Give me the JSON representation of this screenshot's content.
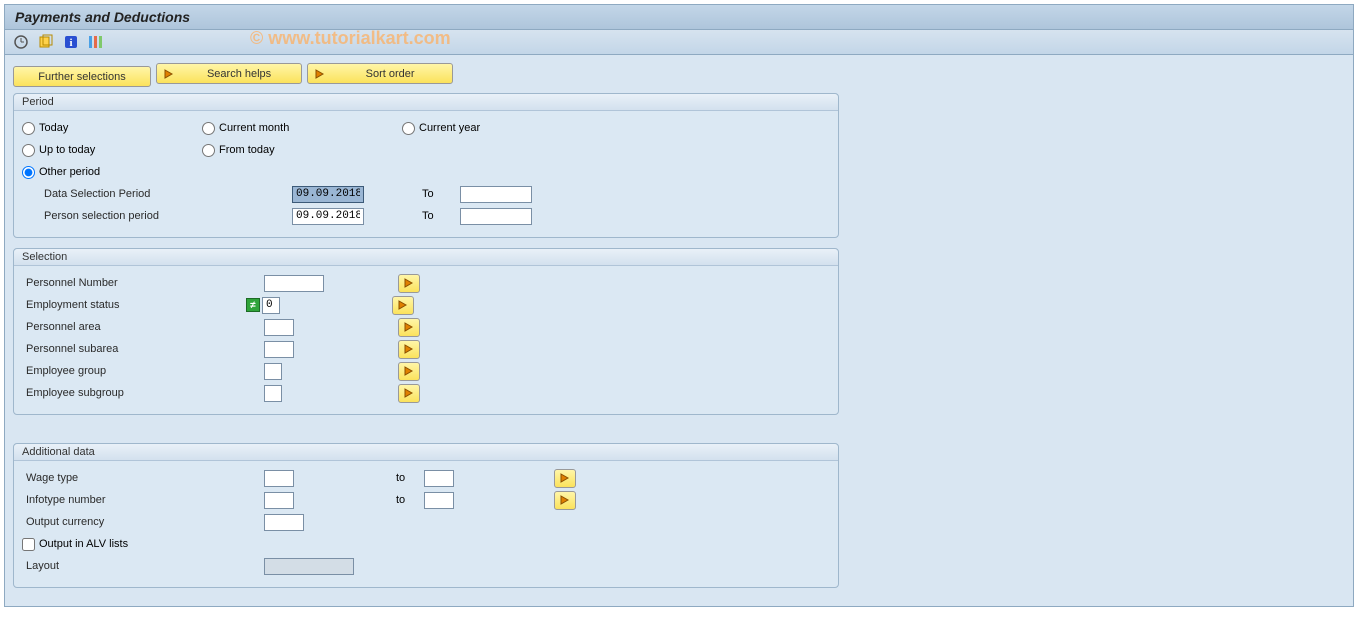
{
  "title": "Payments and Deductions",
  "watermark": "© www.tutorialkart.com",
  "buttons": {
    "further_selections": "Further selections",
    "search_helps": "Search helps",
    "sort_order": "Sort order"
  },
  "period": {
    "legend": "Period",
    "today": "Today",
    "up_to_today": "Up to today",
    "other_period": "Other period",
    "current_month": "Current month",
    "from_today": "From today",
    "current_year": "Current year",
    "data_sel_label": "Data Selection Period",
    "person_sel_label": "Person selection period",
    "to": "To",
    "data_sel_from": "09.09.2018",
    "data_sel_to": "",
    "person_sel_from": "09.09.2018",
    "person_sel_to": ""
  },
  "selection": {
    "legend": "Selection",
    "personnel_number": "Personnel Number",
    "employment_status": "Employment status",
    "employment_status_val": "0",
    "personnel_area": "Personnel area",
    "personnel_subarea": "Personnel subarea",
    "employee_group": "Employee group",
    "employee_subgroup": "Employee subgroup"
  },
  "additional": {
    "legend": "Additional data",
    "wage_type": "Wage type",
    "infotype_number": "Infotype number",
    "output_currency": "Output currency",
    "output_alv": "Output in ALV lists",
    "layout": "Layout",
    "to": "to"
  }
}
